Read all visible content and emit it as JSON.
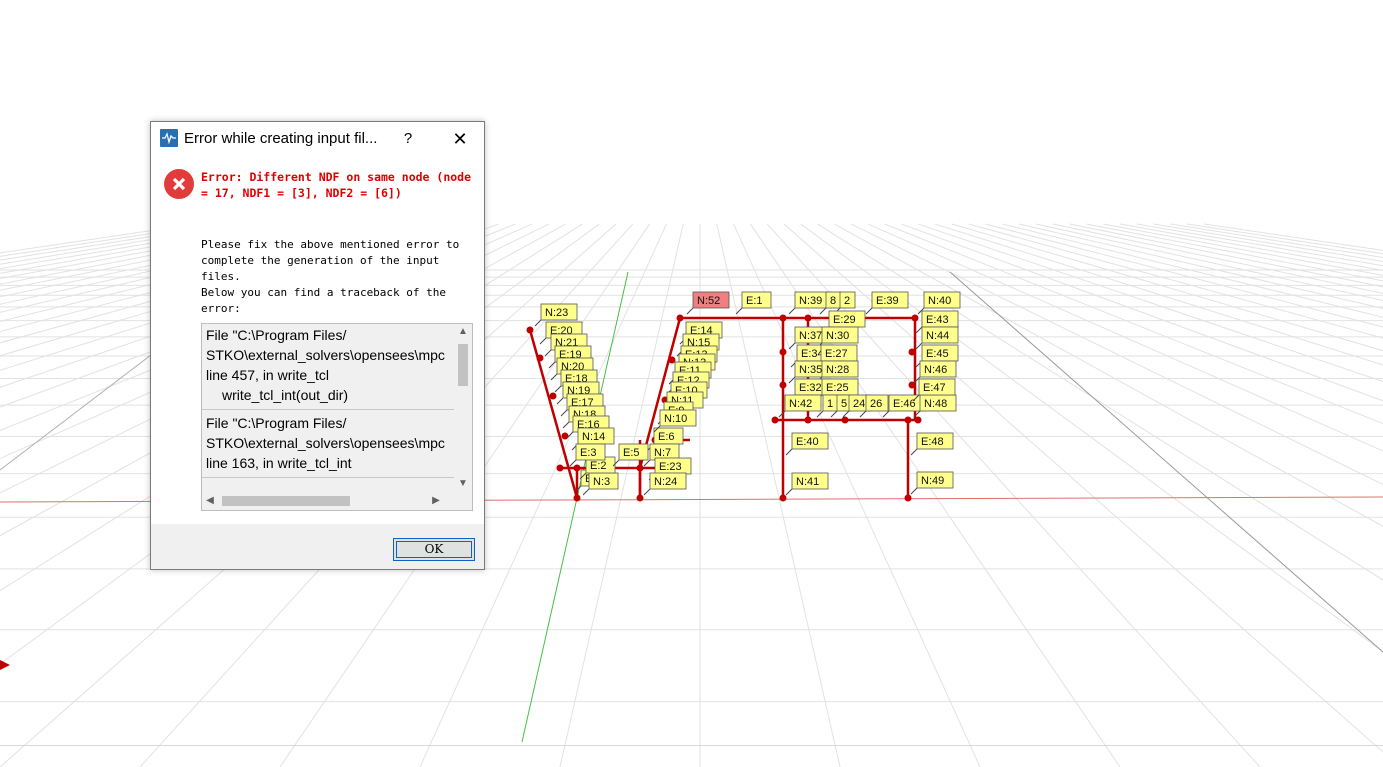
{
  "dialog": {
    "title": "Error while creating input fil...",
    "help_label": "?",
    "close_label": "✕",
    "error_message": "Error: Different NDF on same node (node = 17, NDF1 = [3], NDF2 = [6])",
    "info_message": "Please fix the above mentioned error to complete the generation of the input files.\nBelow you can find a traceback of the error:",
    "traceback": [
      {
        "lines": [
          "File \"C:\\Program Files/",
          "STKO\\external_solvers\\opensees\\mpc",
          "line 457, in write_tcl"
        ],
        "code": "write_tcl_int(out_dir)"
      },
      {
        "lines": [
          "File \"C:\\Program Files/",
          "STKO\\external_solvers\\opensees\\mpc",
          "line 163, in write_tcl_int"
        ],
        "code": ""
      }
    ],
    "ok_label": "OK",
    "colors": {
      "error_text": "#e00000",
      "error_icon": "#e23b3b",
      "ok_border": "#0a64c8"
    }
  },
  "viewport": {
    "labels": [
      {
        "text": "N:52",
        "highlight": true
      },
      {
        "text": "E:1"
      },
      {
        "text": "N:39"
      },
      {
        "text": "8"
      },
      {
        "text": "2"
      },
      {
        "text": "E:39"
      },
      {
        "text": "N:40"
      },
      {
        "text": "N:23"
      },
      {
        "text": "E:20"
      },
      {
        "text": "N:21"
      },
      {
        "text": "E:19"
      },
      {
        "text": "N:20"
      },
      {
        "text": "E:18"
      },
      {
        "text": "N:19"
      },
      {
        "text": "E:17"
      },
      {
        "text": "N:18"
      },
      {
        "text": "E:16"
      },
      {
        "text": "N:14"
      },
      {
        "text": "E:4"
      },
      {
        "text": "N:3"
      },
      {
        "text": "E:2"
      },
      {
        "text": "E:3"
      },
      {
        "text": "E:5"
      },
      {
        "text": "E:6"
      },
      {
        "text": "N:7"
      },
      {
        "text": "E:23"
      },
      {
        "text": "N:24"
      },
      {
        "text": "E:14"
      },
      {
        "text": "N:15"
      },
      {
        "text": "E:13"
      },
      {
        "text": "N:13"
      },
      {
        "text": "E:11"
      },
      {
        "text": "E:12"
      },
      {
        "text": "E:10"
      },
      {
        "text": "N:11"
      },
      {
        "text": "E:9"
      },
      {
        "text": "N:10"
      },
      {
        "text": "E:29"
      },
      {
        "text": "N:37"
      },
      {
        "text": "N:30"
      },
      {
        "text": "E:34"
      },
      {
        "text": "E:27"
      },
      {
        "text": "N:35"
      },
      {
        "text": "N:28"
      },
      {
        "text": "E:32"
      },
      {
        "text": "E:25"
      },
      {
        "text": "N:42"
      },
      {
        "text": "1"
      },
      {
        "text": "5"
      },
      {
        "text": "24"
      },
      {
        "text": "26"
      },
      {
        "text": "E:46"
      },
      {
        "text": "N:48"
      },
      {
        "text": "E:43"
      },
      {
        "text": "N:44"
      },
      {
        "text": "E:45"
      },
      {
        "text": "N:46"
      },
      {
        "text": "E:47"
      },
      {
        "text": "E:40"
      },
      {
        "text": "E:48"
      },
      {
        "text": "N:41"
      },
      {
        "text": "N:49"
      }
    ],
    "colors": {
      "member": "#c00000",
      "label_fill": "#ffff8c",
      "highlight_fill": "#f08080"
    }
  }
}
